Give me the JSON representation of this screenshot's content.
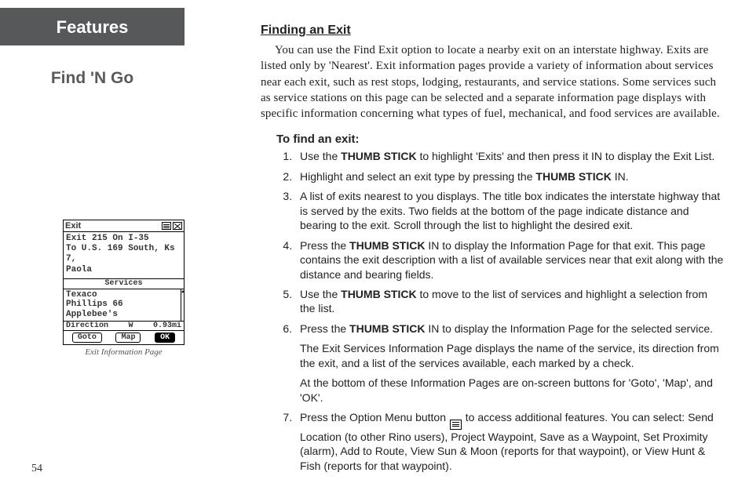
{
  "page_number": "54",
  "left": {
    "features_label": "Features",
    "section_title": "Find 'N Go",
    "caption": "Exit Information Page",
    "device": {
      "title": "Exit",
      "desc_line1": "Exit 215 On I-35",
      "desc_line2": "To U.S. 169 South, Ks 7,",
      "desc_line3": "Paola",
      "services_label": "Services",
      "service1": "Texaco",
      "service2": "Phillips 66",
      "service3": "Applebee's",
      "dir_label": "Direction",
      "dir_value": "W",
      "dist_value": "0.93mi",
      "btn_goto": "Goto",
      "btn_map": "Map",
      "btn_ok": "OK"
    }
  },
  "right": {
    "heading": "Finding an Exit",
    "intro": "You can use the Find Exit option to locate a nearby exit on an interstate highway.  Exits are listed only by 'Nearest'.  Exit information pages provide a variety of information about services near each exit, such as rest stops, lodging, restaurants, and service stations.  Some services such as service stations on this page can be selected and a separate information page displays with specific information concerning what types of fuel, mechanical, and food services are available.",
    "steps_heading": "To find an exit:",
    "thumb_stick": "THUMB STICK",
    "steps": {
      "s1a": "Use the ",
      "s1b": " to highlight 'Exits' and then press it IN to display the Exit List.",
      "s2a": "Highlight and select an exit type by pressing the ",
      "s2b": " IN.",
      "s3": "A list of exits nearest to you displays.  The title box indicates the interstate highway that is served by the exits.  Two fields at the bottom of the page indicate distance and bearing to the exit.  Scroll through the list to highlight the desired exit.",
      "s4a": "Press the ",
      "s4b": " IN to display the Information Page for that exit.  This page contains the exit description with a list of available services near that exit along with the distance and bearing fields.",
      "s5a": "Use the ",
      "s5b": " to move to the list of services and highlight a selection from the list.",
      "s6a": "Press the ",
      "s6b": " IN to display the Information Page for the selected service.",
      "s6sub1": "The Exit Services Information Page displays the name of the service, its direction from the exit, and a list of the services available, each marked by a check.",
      "s6sub2": "At the bottom of these Information Pages are on-screen buttons for 'Goto', 'Map', and 'OK'.",
      "s7a": "Press the Option Menu button ",
      "s7b": " to access additional features.  You can select: Send Location (to other Rino users), Project Waypoint, Save as a Waypoint, Set Proximity (alarm), Add to Route, View Sun & Moon (reports for that waypoint), or View Hunt & Fish (reports for that waypoint)."
    }
  }
}
